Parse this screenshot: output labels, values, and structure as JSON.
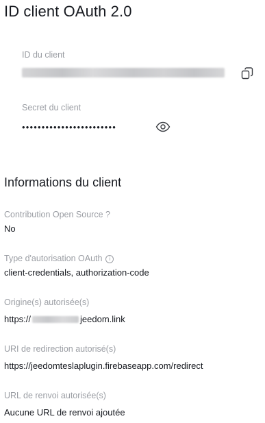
{
  "title": "ID client OAuth 2.0",
  "client_id": {
    "label": "ID du client",
    "copy_icon": "copy-icon"
  },
  "client_secret": {
    "label": "Secret du client",
    "masked_value": "••••••••••••••••••••••••",
    "reveal_icon": "eye-icon"
  },
  "client_info": {
    "section_title": "Informations du client",
    "open_source": {
      "label": "Contribution Open Source ?",
      "value": "No"
    },
    "auth_type": {
      "label": "Type d'autorisation OAuth",
      "info_icon": "info-icon",
      "value": "client-credentials, authorization-code"
    },
    "origins": {
      "label": "Origine(s) autorisée(s)",
      "value_prefix": "https://",
      "value_suffix": "jeedom.link"
    },
    "redirect_uri": {
      "label": "URI de redirection autorisé(s)",
      "value": "https://jeedomteslaplugin.firebaseapp.com/redirect"
    },
    "return_url": {
      "label": "URL de renvoi autorisée(s)",
      "value": "Aucune URL de renvoi ajoutée"
    }
  }
}
